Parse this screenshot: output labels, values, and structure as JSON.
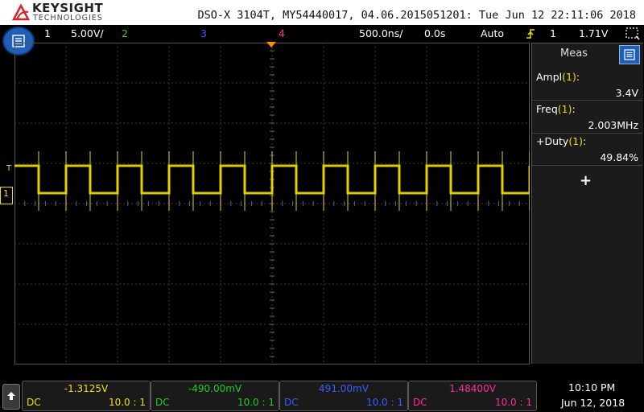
{
  "header": {
    "brand": "KEYSIGHT",
    "brand_sub": "TECHNOLOGIES",
    "title": "DSO-X 3104T, MY54440017, 04.06.2015051201: Tue Jun 12 22:11:06 2018"
  },
  "channel_bar": {
    "ch1_num": "1",
    "ch1_scale": "5.00V/",
    "ch2_num": "2",
    "ch3_num": "3",
    "ch4_num": "4",
    "timebase": "500.0ns/",
    "delay": "0.0s",
    "trigger_mode": "Auto",
    "trigger_source": "1",
    "trigger_level": "1.71V"
  },
  "colors": {
    "ch1": "#f0e000",
    "ch2": "#22cc22",
    "ch3": "#3a5cff",
    "ch4": "#ff2ea0",
    "accent": "#1f5fb6"
  },
  "measurements": {
    "panel_title": "Meas",
    "items": [
      {
        "label": "Ampl",
        "channel": "(1)",
        "close": ":",
        "value": "3.4V"
      },
      {
        "label": "Freq",
        "channel": "(1)",
        "close": ":",
        "value": "2.003MHz"
      },
      {
        "label": "+Duty",
        "channel": "(1)",
        "close": ":",
        "value": "49.84%"
      }
    ],
    "add_symbol": "+"
  },
  "markers": {
    "trigger": "T",
    "ch1_ground": "1"
  },
  "bottom": {
    "channels": [
      {
        "offset": "-1.3125V",
        "coupling": "DC",
        "probe": "10.0 : 1"
      },
      {
        "offset": "-490.00mV",
        "coupling": "DC",
        "probe": "10.0 : 1"
      },
      {
        "offset": "491.00mV",
        "coupling": "DC",
        "probe": "10.0 : 1"
      },
      {
        "offset": "1.48400V",
        "coupling": "DC",
        "probe": "10.0 : 1"
      }
    ],
    "time": "10:10 PM",
    "date": "Jun 12, 2018"
  }
}
